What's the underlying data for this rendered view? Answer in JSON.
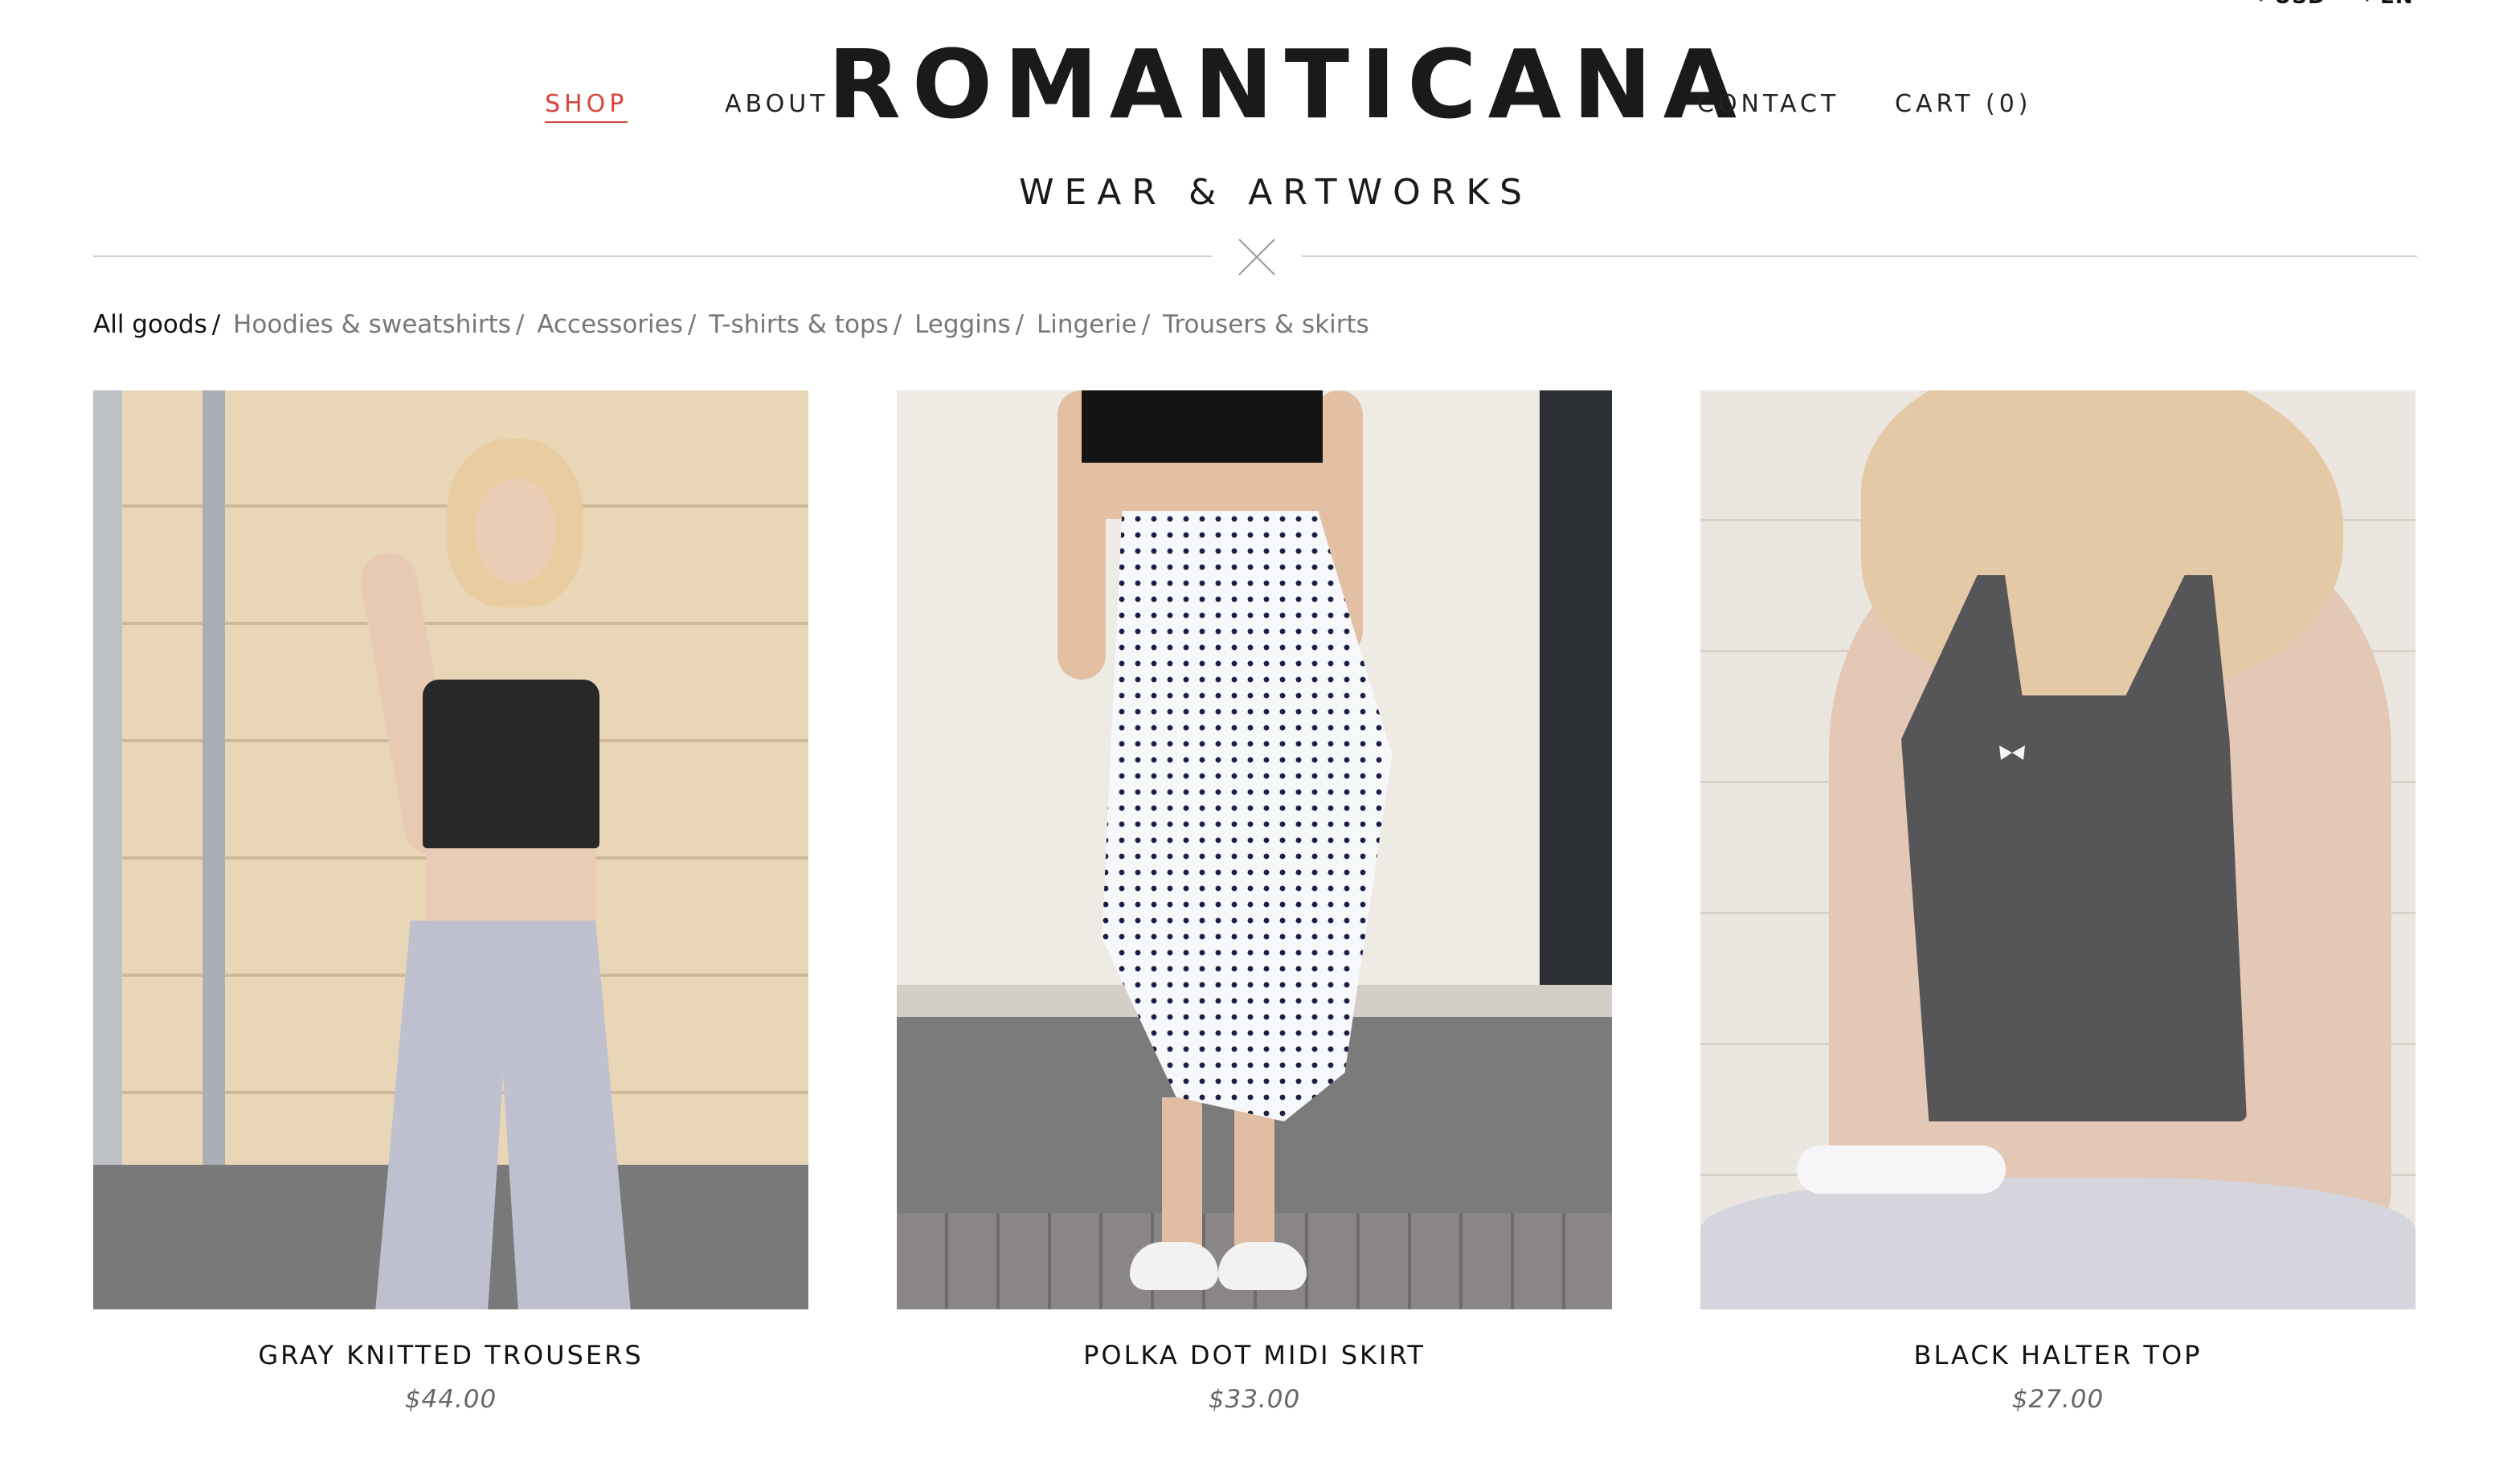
{
  "header": {
    "currency": "USD",
    "language": "EN",
    "nav": {
      "shop": "SHOP",
      "about": "ABOUT",
      "contact": "CONTACT",
      "cart": "CART (0)"
    },
    "logo": "ROMANTICANA",
    "tagline": "WEAR & ARTWORKS"
  },
  "categories": [
    {
      "label": "All goods",
      "active": true
    },
    {
      "label": "Hoodies & sweatshirts",
      "active": false
    },
    {
      "label": "Accessories",
      "active": false
    },
    {
      "label": "T-shirts & tops",
      "active": false
    },
    {
      "label": "Leggins",
      "active": false
    },
    {
      "label": "Lingerie",
      "active": false
    },
    {
      "label": "Trousers & skirts",
      "active": false
    }
  ],
  "products": [
    {
      "name": "GRAY KNITTED TROUSERS",
      "price": "$44.00"
    },
    {
      "name": "POLKA DOT MIDI SKIRT",
      "price": "$33.00"
    },
    {
      "name": "BLACK HALTER TOP",
      "price": "$27.00"
    }
  ],
  "colors": {
    "accent": "#d8453b",
    "text": "#1a1a1a",
    "muted": "#777777"
  }
}
